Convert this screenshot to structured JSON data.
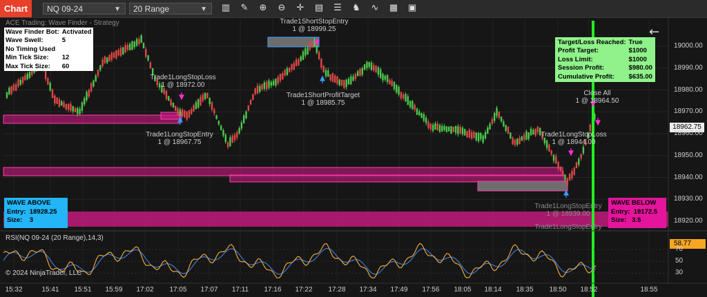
{
  "toolbar": {
    "tab": "Chart",
    "instrument": "NQ 09-24",
    "period": "20 Range",
    "tools": [
      "bar-chart-icon",
      "pencil-icon",
      "zoom-in-icon",
      "zoom-out-icon",
      "crosshair-icon",
      "data-box-icon",
      "properties-icon",
      "strategy-icon",
      "indicators-icon",
      "templates-icon"
    ]
  },
  "strategy_label": "ACE Trading: Wave Finder - Strategy",
  "bot_info": {
    "rows": [
      {
        "k": "Wave Finder Bot:",
        "v": "Activated"
      },
      {
        "k": "Wave Swell:",
        "v": "5"
      },
      {
        "k": "No Timing Used",
        "v": ""
      },
      {
        "k": "Min Tick Size:",
        "v": "12"
      },
      {
        "k": "Max Tick Size:",
        "v": "60"
      }
    ]
  },
  "target_info": {
    "rows": [
      {
        "k": "Target/Loss Reached:",
        "v": "True"
      },
      {
        "k": "Profit Target:",
        "v": "$1000"
      },
      {
        "k": "Loss Limit:",
        "v": "$1000"
      },
      {
        "k": "Session Profit:",
        "v": "$980.00"
      },
      {
        "k": "Cumulative Profit:",
        "v": "$635.00"
      }
    ]
  },
  "wave_above": {
    "title": "WAVE ABOVE",
    "entry_label": "Entry:",
    "entry": "18928.25",
    "size_label": "Size:",
    "size": "3"
  },
  "wave_below": {
    "title": "WAVE BELOW",
    "entry_label": "Entry:",
    "entry": "19172.5",
    "size_label": "Size:",
    "size": "3.5"
  },
  "trades": {
    "short_entry": {
      "name": "Trade1ShortStopEntry",
      "fill": "1 @ 18999.25"
    },
    "short_target": {
      "name": "Trade1ShortProfitTarget",
      "fill": "1 @ 18985.75"
    },
    "long_stoploss_1": {
      "name": "Trade1LongStopLoss",
      "fill": "1 @ 18972.00"
    },
    "long_entry_1": {
      "name": "Trade1LongStopEntry",
      "fill": "1 @ 18967.75"
    },
    "close_all": {
      "name": "Close All",
      "fill": "1 @ 18964.50"
    },
    "long_stoploss_2": {
      "name": "Trade1LongStopLoss",
      "fill": "1 @ 18944.00"
    },
    "long_entry_2": {
      "name": "Trade1LongStopEntry",
      "fill": "1 @ 18939.00"
    },
    "long_entry_3": {
      "name": "Trade1LongStopEntry",
      "fill": ""
    }
  },
  "price_axis": {
    "ticks": [
      "19000.00",
      "18990.00",
      "18980.00",
      "18970.00",
      "18960.00",
      "18950.00",
      "18940.00",
      "18930.00",
      "18920.00"
    ],
    "current": "18962.75"
  },
  "rsi": {
    "label": "RSI(NQ 09-24 (20 Range),14,3)",
    "ticks": [
      "70",
      "50",
      "30"
    ],
    "current": "58.77",
    "copyright": "© 2024 NinjaTrader, LLC"
  },
  "time_axis": {
    "ticks": [
      "15:32",
      "15:41",
      "15:51",
      "15:59",
      "17:02",
      "17:05",
      "17:07",
      "17:11",
      "17:16",
      "17:22",
      "17:28",
      "17:34",
      "17:49",
      "17:56",
      "18:05",
      "18:14",
      "18:35",
      "18:50",
      "18:52",
      "18:55"
    ]
  },
  "colors": {
    "up": "#4cc94c",
    "down": "#e04848",
    "zone_fill": "#d81b8a",
    "zone_gray": "#6d6d6d",
    "zone_border": "#ff3fb0",
    "vline": "#22ee22",
    "wave_above_bg": "#23b5f5",
    "wave_below_bg": "#e4159c",
    "target_bg": "#8ff28a",
    "rsi_line": "#e8a33c",
    "rsi_line2": "#3a7bd5"
  }
}
